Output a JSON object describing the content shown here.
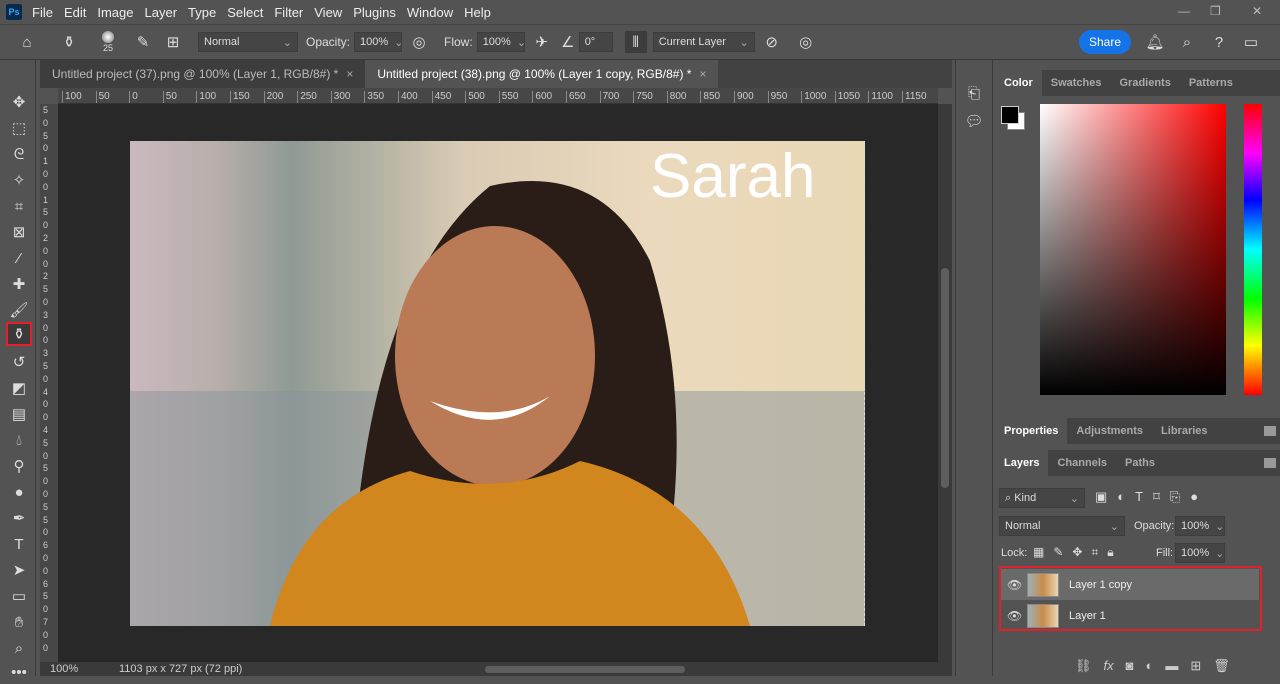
{
  "menu": [
    "File",
    "Edit",
    "Image",
    "Layer",
    "Type",
    "Select",
    "Filter",
    "View",
    "Plugins",
    "Window",
    "Help"
  ],
  "app_icon": "Ps",
  "options": {
    "brush_size": "25",
    "mode": "Normal",
    "opacity_label": "Opacity:",
    "opacity": "100%",
    "flow_label": "Flow:",
    "flow": "100%",
    "angle": "0°",
    "sample": "Current Layer",
    "share": "Share"
  },
  "tabs": [
    {
      "label": "Untitled project (37).png @ 100% (Layer 1, RGB/8#) *"
    },
    {
      "label": "Untitled project (38).png @ 100% (Layer 1 copy, RGB/8#) *"
    }
  ],
  "ruler_h": [
    "100",
    "50",
    "0",
    "50",
    "100",
    "150",
    "200",
    "250",
    "300",
    "350",
    "400",
    "450",
    "500",
    "550",
    "600",
    "650",
    "700",
    "750",
    "800",
    "850",
    "900",
    "950",
    "1000",
    "1050",
    "1100",
    "1150"
  ],
  "ruler_v": [
    "5",
    "0",
    "5",
    "0",
    "1",
    "0",
    "0",
    "1",
    "5",
    "0",
    "2",
    "0",
    "0",
    "2",
    "5",
    "0",
    "3",
    "0",
    "0",
    "3",
    "5",
    "0",
    "4",
    "0",
    "0",
    "4",
    "5",
    "0",
    "5",
    "0",
    "0",
    "5",
    "5",
    "0",
    "6",
    "0",
    "0",
    "6",
    "5",
    "0",
    "7",
    "0",
    "0"
  ],
  "canvas": {
    "text": "Sarah"
  },
  "status": {
    "zoom": "100%",
    "info": "1103 px x 727 px (72 ppi)"
  },
  "color_tabs": [
    "Color",
    "Swatches",
    "Gradients",
    "Patterns"
  ],
  "prop_tabs": [
    "Properties",
    "Adjustments",
    "Libraries"
  ],
  "layer_tabs": [
    "Layers",
    "Channels",
    "Paths"
  ],
  "layers_panel": {
    "filter": "Kind",
    "blend": "Normal",
    "opacity_label": "Opacity:",
    "opacity": "100%",
    "lock_label": "Lock:",
    "fill_label": "Fill:",
    "fill": "100%",
    "layers": [
      {
        "name": "Layer 1 copy",
        "selected": true
      },
      {
        "name": "Layer 1",
        "selected": false
      }
    ]
  },
  "colors": {
    "accent": "#1473e6",
    "highlight": "#e0202a"
  }
}
